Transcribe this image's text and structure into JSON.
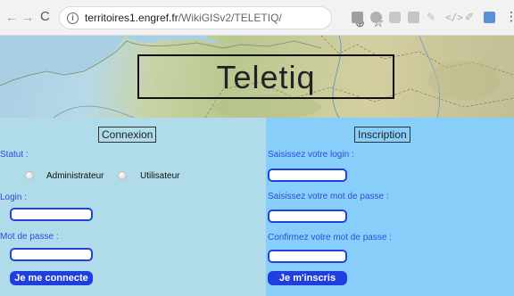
{
  "browser": {
    "url_host": "territoires1.engref.fr",
    "url_path": "/WikiGISv2/TELETIQ/",
    "nav_back": "←",
    "nav_forward": "→",
    "nav_reload": "C",
    "info_icon": "i",
    "zoom_icon": "⊕",
    "star_icon": "☆",
    "menu_icon": "⋮",
    "ext_icons": [
      "puzzle-icon",
      "circle-icon",
      "chat-icon",
      "pdf-icon",
      "feather-icon",
      "code-icon",
      "pen-icon",
      "bookmark-icon"
    ]
  },
  "banner": {
    "title": "Teletiq"
  },
  "login": {
    "heading": "Connexion",
    "status_label": "Statut :",
    "radio_admin": "Administrateur",
    "radio_user": "Utilisateur",
    "login_label": "Login :",
    "password_label": "Mot de passe :",
    "submit_label": "Je me connecte"
  },
  "signup": {
    "heading": "Inscription",
    "login_label": "Saisissez votre login :",
    "password_label": "Saisissez votre mot de passe :",
    "confirm_label": "Confirmez votre mot de passe :",
    "submit_label": "Je m'inscris"
  },
  "colors": {
    "left_panel_bg": "#b0dbe8",
    "right_panel_bg": "#87cefa",
    "label_blue": "#2d4bdb",
    "button_blue": "#1f3ee0"
  }
}
